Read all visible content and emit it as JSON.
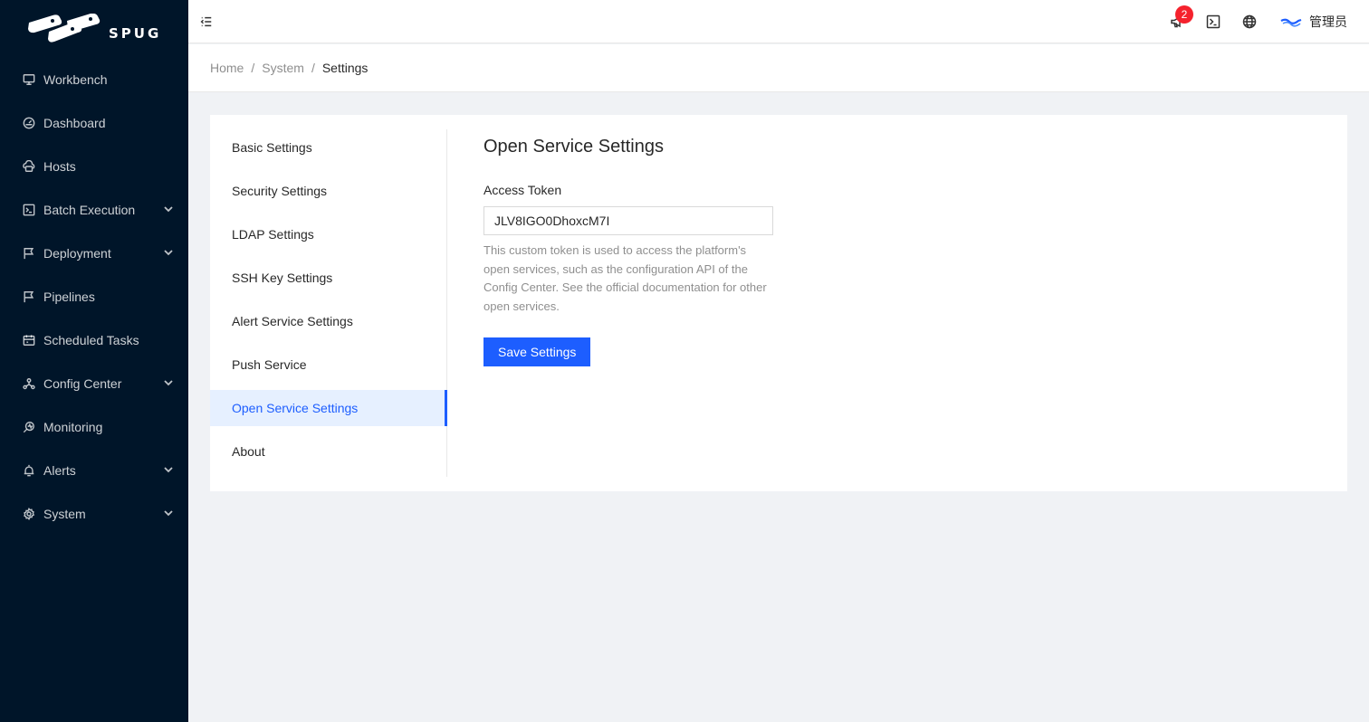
{
  "app": {
    "logo_text": "SPUG"
  },
  "sidebar": {
    "items": [
      {
        "label": "Workbench",
        "icon": "desktop-icon",
        "has_children": false
      },
      {
        "label": "Dashboard",
        "icon": "dashboard-icon",
        "has_children": false
      },
      {
        "label": "Hosts",
        "icon": "cloud-server-icon",
        "has_children": false
      },
      {
        "label": "Batch Execution",
        "icon": "code-icon",
        "has_children": true
      },
      {
        "label": "Deployment",
        "icon": "flag-icon",
        "has_children": true
      },
      {
        "label": "Pipelines",
        "icon": "flag-icon",
        "has_children": false
      },
      {
        "label": "Scheduled Tasks",
        "icon": "schedule-icon",
        "has_children": false
      },
      {
        "label": "Config Center",
        "icon": "deployment-unit-icon",
        "has_children": true
      },
      {
        "label": "Monitoring",
        "icon": "monitor-icon",
        "has_children": false
      },
      {
        "label": "Alerts",
        "icon": "alert-icon",
        "has_children": true
      },
      {
        "label": "System",
        "icon": "setting-icon",
        "has_children": true
      }
    ]
  },
  "header": {
    "notification_count": "2",
    "user_name": "管理员"
  },
  "breadcrumb": [
    "Home",
    "System",
    "Settings"
  ],
  "settings_nav": {
    "items": [
      "Basic Settings",
      "Security Settings",
      "LDAP Settings",
      "SSH Key Settings",
      "Alert Service Settings",
      "Push Service",
      "Open Service Settings",
      "About"
    ],
    "active_index": 6
  },
  "panel": {
    "title": "Open Service Settings",
    "field_label": "Access Token",
    "token_value": "JLV8IGO0DhoxcM7I",
    "help_text": "This custom token is used to access the platform's open services, such as the configuration API of the Config Center. See the official documentation for other open services.",
    "save_label": "Save Settings"
  },
  "colors": {
    "sidebar_bg": "#001529",
    "primary": "#1d5eff",
    "badge": "#f5222d",
    "page_bg": "#f0f2f5"
  }
}
